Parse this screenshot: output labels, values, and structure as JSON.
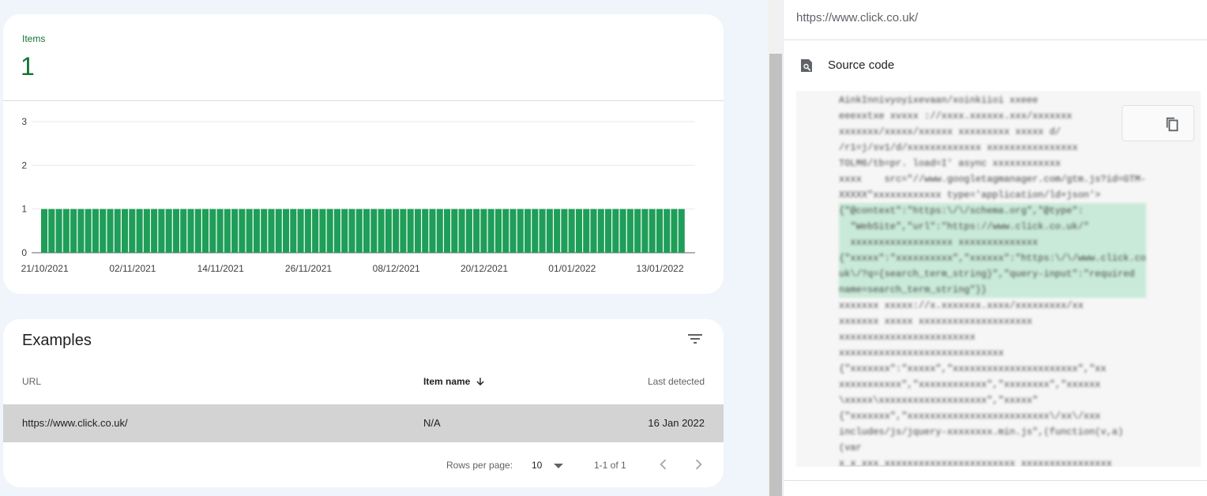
{
  "summary": {
    "label": "Items",
    "count": "1"
  },
  "chart_data": {
    "type": "bar",
    "title": "",
    "xlabel": "",
    "ylabel": "",
    "ylim": [
      0,
      3
    ],
    "yticks": [
      "0",
      "1",
      "2",
      "3"
    ],
    "xtick_labels": [
      "21/10/2021",
      "02/11/2021",
      "14/11/2021",
      "26/11/2021",
      "08/12/2021",
      "20/12/2021",
      "01/01/2022",
      "13/01/2022"
    ],
    "start_date": "21/10/2021",
    "end_date": "16/01/2022",
    "values": [
      1,
      1,
      1,
      1,
      1,
      1,
      1,
      1,
      1,
      1,
      1,
      1,
      1,
      1,
      1,
      1,
      1,
      1,
      1,
      1,
      1,
      1,
      1,
      1,
      1,
      1,
      1,
      1,
      1,
      1,
      1,
      1,
      1,
      1,
      1,
      1,
      1,
      1,
      1,
      1,
      1,
      1,
      1,
      1,
      1,
      1,
      1,
      1,
      1,
      1,
      1,
      1,
      1,
      1,
      1,
      1,
      1,
      1,
      1,
      1,
      1,
      1,
      1,
      1,
      1,
      1,
      1,
      1,
      1,
      1,
      1,
      1,
      1,
      1,
      1,
      1,
      1,
      1,
      1,
      1,
      1,
      1,
      1,
      1,
      1,
      1,
      1,
      1
    ],
    "color": "#1e9e58",
    "grid": true
  },
  "examples": {
    "title": "Examples",
    "columns": {
      "url": "URL",
      "item_name": "Item name",
      "last_detected": "Last detected"
    },
    "rows": [
      {
        "url": "https://www.click.co.uk/",
        "item_name": "N/A",
        "last_detected": "16 Jan 2022"
      }
    ],
    "pagination": {
      "rows_per_page_label": "Rows per page:",
      "rows_per_page": "10",
      "range": "1-1 of 1"
    }
  },
  "panel": {
    "url": "https://www.click.co.uk/",
    "section_title": "Source code",
    "code_lines": [
      "AinkInnivyoyixevaan/xoinkiioi xxeee",
      "eeexxtxe xvxxx ://xxxx.xxxxxx.xxx/xxxxxxx",
      "xxxxxxx/xxxxx/xxxxxx xxxxxxxxx xxxxx d/",
      "/r1=j/sv1/d/xxxxxxxxxxxxx xxxxxxxxxxxxxxxx",
      "TOLM6/tb=pr. load=I' async xxxxxxxxxxxx",
      "xxxx    src=\"//www.googletagmanager.com/gtm.js?id=GTM-",
      "XXXXX\"xxxxxxxxxxxx type='application/ld+json'>",
      "{\"@context\":\"https:\\/\\/schema.org\",\"@type\":",
      "  \"WebSite\",\"url\":\"https://www.click.co.uk/\"",
      "  xxxxxxxxxxxxxxxxxx xxxxxxxxxxxxxx",
      "{\"xxxxx\":\"xxxxxxxxxx\",\"xxxxxx\":\"https:\\/\\/www.click.co",
      "uk\\/?q={search_term_string}\",\"query-input\":\"required",
      "name=search_term_string\"}}",
      "xxxxxxx xxxxx://x.xxxxxxx.xxxx/xxxxxxxxx/xx",
      "xxxxxxx xxxxx xxxxxxxxxxxxxxxxxxxx",
      "xxxxxxxxxxxxxxxxxxxxxxxx",
      "xxxxxxxxxxxxxxxxxxxxxxxxxxxxx",
      "{\"xxxxxxx\":\"xxxxx\",\"xxxxxxxxxxxxxxxxxxxxxx\",\"xx",
      "xxxxxxxxxxx\",\"xxxxxxxxxxxx\",\"xxxxxxxx\",\"xxxxxx",
      "\\xxxxx\\xxxxxxxxxxxxxxxxxxx\",\"xxxxx\"",
      "{\"xxxxxxx\",\"xxxxxxxxxxxxxxxxxxxxxxxxx\\/xx\\/xxx",
      "includes/js/jquery-xxxxxxxx.min.js\",(function(v,a)",
      "(var",
      "x_x_xxx_xxxxxxxxxxxxxxxxxxxxxxx xxxxxxxxxxxxxxxx"
    ]
  }
}
